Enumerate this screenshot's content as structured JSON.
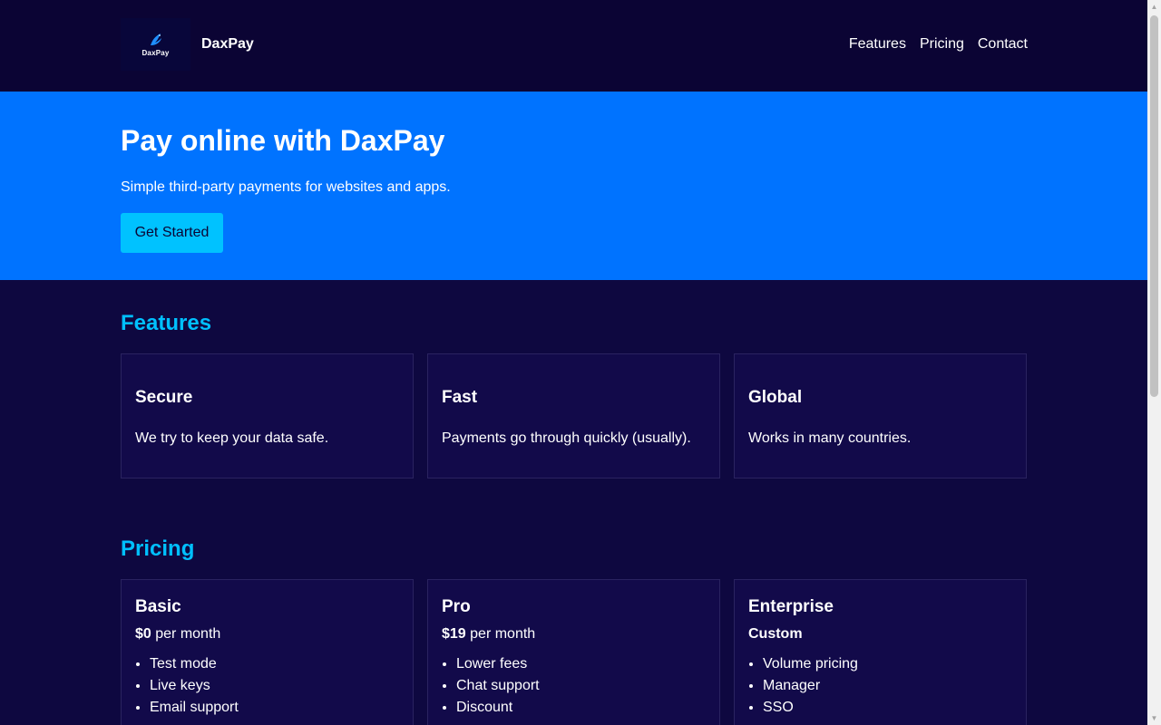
{
  "header": {
    "logo_text": "DaxPay",
    "brand": "DaxPay",
    "nav": [
      "Features",
      "Pricing",
      "Contact"
    ]
  },
  "hero": {
    "title": "Pay online with DaxPay",
    "subtitle": "Simple third-party payments for websites and apps.",
    "cta": "Get Started"
  },
  "features": {
    "title": "Features",
    "cards": [
      {
        "title": "Secure",
        "text": "We try to keep your data safe."
      },
      {
        "title": "Fast",
        "text": "Payments go through quickly (usually)."
      },
      {
        "title": "Global",
        "text": "Works in many countries."
      }
    ]
  },
  "pricing": {
    "title": "Pricing",
    "plans": [
      {
        "name": "Basic",
        "price": "$0",
        "period": " per month",
        "items": [
          "Test mode",
          "Live keys",
          "Email support"
        ]
      },
      {
        "name": "Pro",
        "price": "$19",
        "period": " per month",
        "items": [
          "Lower fees",
          "Chat support",
          "Discount"
        ]
      },
      {
        "name": "Enterprise",
        "price": "Custom",
        "period": "",
        "items": [
          "Volume pricing",
          "Manager",
          "SSO"
        ]
      }
    ]
  },
  "colors": {
    "header_bg": "#0b0434",
    "hero_bg": "#0073ff",
    "accent": "#00c0ff",
    "cta_bg": "#00c2ff",
    "page_bg": "#0e0840",
    "card_bg": "#120a4a"
  },
  "icons": {
    "logo": "bird-logo-icon",
    "scroll_up": "scroll-up-arrow-icon",
    "scroll_down": "scroll-down-arrow-icon"
  }
}
